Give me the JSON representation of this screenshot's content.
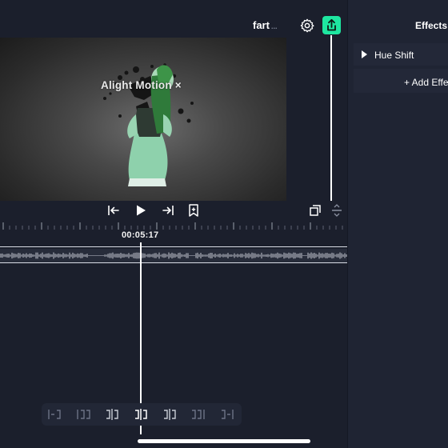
{
  "header": {
    "project_title": "fart",
    "title_suffix": "..."
  },
  "preview": {
    "watermark": "Alight Motion ×"
  },
  "timeline": {
    "timecode": "00:05:17"
  },
  "effects_panel": {
    "title": "Effects",
    "items": [
      {
        "label": "Hue Shift"
      }
    ],
    "add_label": "+ Add Effect"
  },
  "colors": {
    "background": "#1b1f2c",
    "panel": "#1f2433",
    "accent_export": "#1ee6a0"
  },
  "icons": {
    "settings": "gear-icon",
    "export": "share-export-icon",
    "skip_start": "skip-to-start-icon",
    "play": "play-icon",
    "skip_end": "skip-to-end-icon",
    "bookmark": "bookmark-add-icon",
    "copy_layer": "layers-copy-icon",
    "align": "align-center-icon"
  }
}
